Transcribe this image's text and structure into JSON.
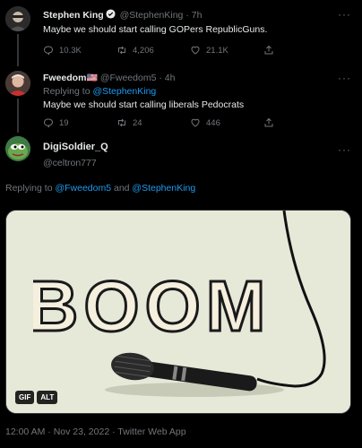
{
  "tweets": [
    {
      "name": "Stephen King",
      "handle": "@StephenKing",
      "time": "7h",
      "text": "Maybe we should start calling GOPers RepublicGuns.",
      "replies": "10.3K",
      "retweets": "4,206",
      "likes": "21.1K",
      "verified": true
    },
    {
      "name": "Fweedom",
      "flag": "🇺🇸",
      "handle": "@Fweedom5",
      "time": "4h",
      "replying_prefix": "Replying to ",
      "replying_to": "@StephenKing",
      "text": "Maybe we should start calling liberals Pedocrats",
      "replies": "19",
      "retweets": "24",
      "likes": "446"
    }
  ],
  "main": {
    "name": "DigiSoldier_Q",
    "handle": "@celtron777",
    "replying_prefix": "Replying to ",
    "replying_to_1": "@Fweedom5",
    "and": " and ",
    "replying_to_2": "@StephenKing",
    "media": {
      "word": "BOOM",
      "badge_gif": "GIF",
      "badge_alt": "ALT"
    },
    "timestamp": "12:00 AM · Nov 23, 2022 · Twitter Web App"
  },
  "ui": {
    "more": "···",
    "dot": "·"
  },
  "colors": {
    "background": "#000000",
    "accent": "#1d9bf0",
    "muted": "#71767b",
    "media_bg": "#e7e9d9"
  }
}
